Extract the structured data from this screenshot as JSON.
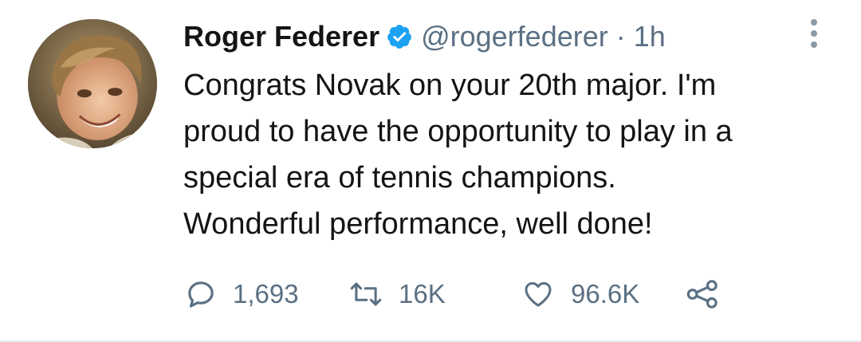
{
  "tweet": {
    "author": {
      "display_name": "Roger Federer",
      "handle": "@rogerfederer",
      "verified": true,
      "avatar_icon": "profile-photo-child"
    },
    "separator": "·",
    "time": "1h",
    "text_lines": [
      "Congrats Novak on your 20th major. I'm",
      "proud to have the opportunity to play in a",
      "special era of tennis champions.",
      "Wonderful performance, well done!"
    ],
    "actions": {
      "reply": {
        "icon": "reply-icon",
        "count": "1,693"
      },
      "retweet": {
        "icon": "retweet-icon",
        "count": "16K"
      },
      "like": {
        "icon": "heart-icon",
        "count": "96.6K"
      },
      "share": {
        "icon": "share-icon"
      }
    },
    "more_icon": "more-options-icon"
  },
  "colors": {
    "text": "#141414",
    "secondary": "#5b7083",
    "verified": "#1da1f2",
    "background": "#ffffff"
  }
}
